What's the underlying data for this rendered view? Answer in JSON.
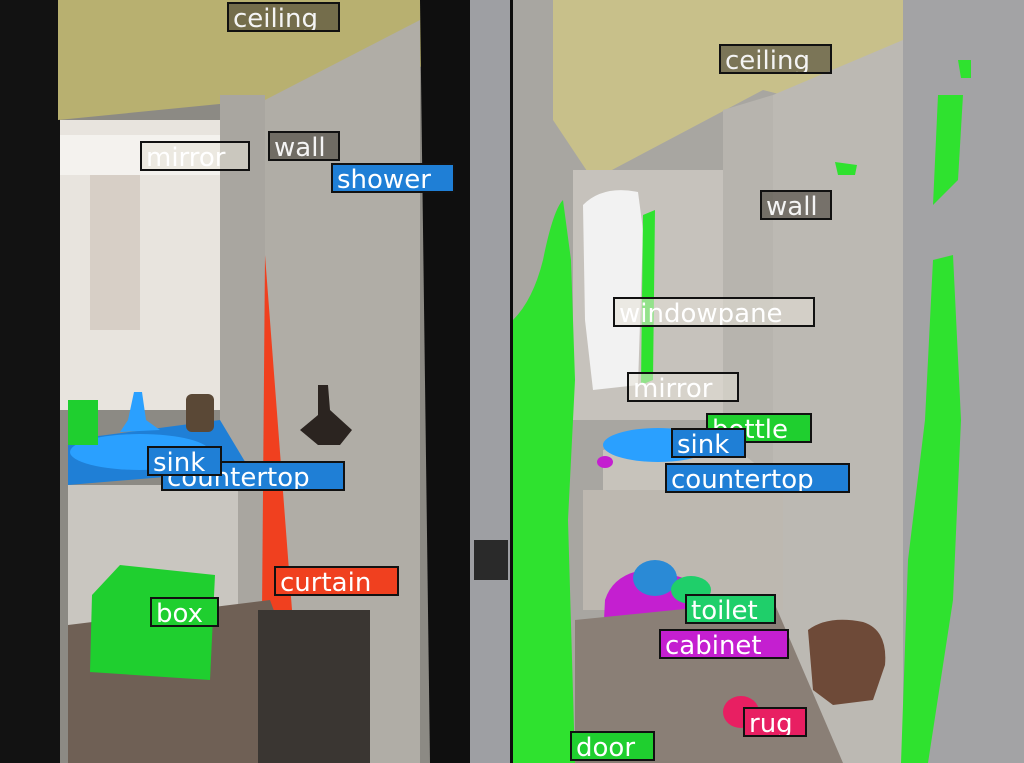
{
  "panels": {
    "left": {
      "labels": {
        "ceiling": "ceiling",
        "mirror": "mirror",
        "wall": "wall",
        "shower": "shower",
        "sink": "sink",
        "countertop": "countertop",
        "curtain": "curtain",
        "box": "box"
      }
    },
    "right": {
      "labels": {
        "ceiling": "ceiling",
        "wall": "wall",
        "windowpane": "windowpane",
        "mirror": "mirror",
        "bottle": "bottle",
        "sink": "sink",
        "countertop": "countertop",
        "toilet": "toilet",
        "cabinet": "cabinet",
        "rug": "rug",
        "door": "door"
      }
    }
  },
  "colors": {
    "ceiling": "#b8b070",
    "wall": "#9d9a92",
    "shower": "#1f7fd6",
    "sink": "#2aa0ff",
    "countertop": "#1f7fd6",
    "curtain": "#f0401f",
    "box": "#1fcf2f",
    "door": "#2fe22f",
    "cabinet": "#c41fd0",
    "toilet": "#1fcf6a",
    "rug": "#e81f62",
    "windowpane": "#f2f2f2"
  }
}
